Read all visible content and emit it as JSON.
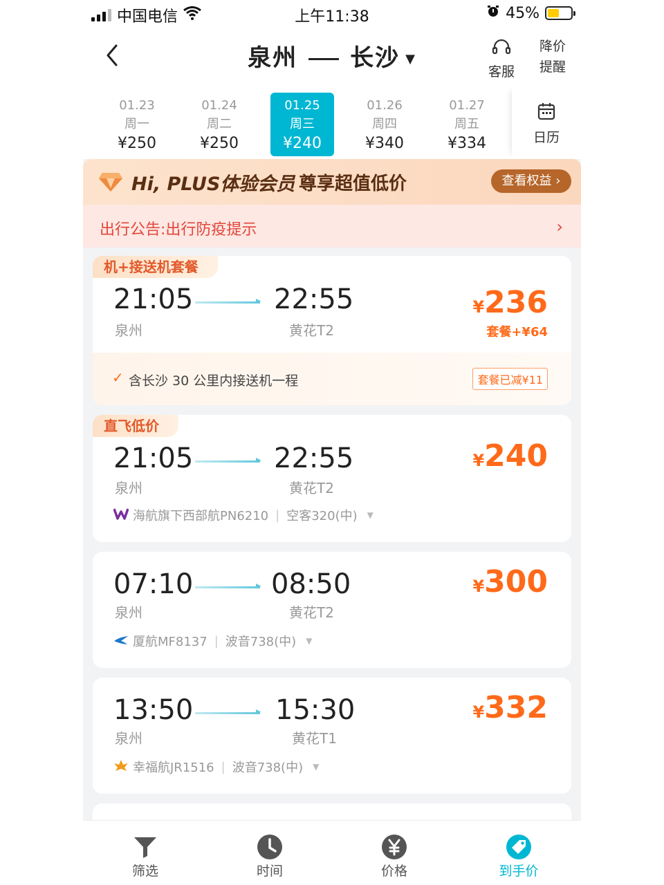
{
  "status_bar": {
    "carrier": "中国电信",
    "time": "上午11:38",
    "battery": "45%"
  },
  "header": {
    "from": "泉州",
    "to": "长沙",
    "service_label": "客服",
    "alert_label_1": "降价",
    "alert_label_2": "提醒"
  },
  "dates": [
    {
      "date": "01.23",
      "weekday": "周一",
      "price": "¥250"
    },
    {
      "date": "01.24",
      "weekday": "周二",
      "price": "¥250"
    },
    {
      "date": "01.25",
      "weekday": "周三",
      "price": "¥240"
    },
    {
      "date": "01.26",
      "weekday": "周四",
      "price": "¥340"
    },
    {
      "date": "01.27",
      "weekday": "周五",
      "price": "¥334"
    }
  ],
  "calendar_label": "日历",
  "plus_banner": {
    "text": "Hi, PLUS体验会员",
    "subtext": "尊享超值低价",
    "cta": "查看权益 ›"
  },
  "notice": {
    "text": "出行公告:出行防疫提示",
    "chevron": "›"
  },
  "flights": [
    {
      "tag": "机+接送机套餐",
      "dep_time": "21:05",
      "dep_city": "泉州",
      "arr_time": "22:55",
      "arr_city": "黄花T2",
      "currency": "¥",
      "price": "236",
      "extra": "套餐+¥64",
      "include_check": "✓",
      "include_text": "含长沙 30 公里内接送机一程",
      "discount_badge": "套餐已减¥11"
    },
    {
      "tag": "直飞低价",
      "dep_time": "21:05",
      "dep_city": "泉州",
      "arr_time": "22:55",
      "arr_city": "黄花T2",
      "currency": "¥",
      "price": "240",
      "airline": "海航旗下西部航PN6210",
      "aircraft": "空客320(中)"
    },
    {
      "dep_time": "07:10",
      "dep_city": "泉州",
      "arr_time": "08:50",
      "arr_city": "黄花T2",
      "currency": "¥",
      "price": "300",
      "airline": "厦航MF8137",
      "aircraft": "波音738(中)"
    },
    {
      "dep_time": "13:50",
      "dep_city": "泉州",
      "arr_time": "15:30",
      "arr_city": "黄花T1",
      "currency": "¥",
      "price": "332",
      "airline": "幸福航JR1516",
      "aircraft": "波音738(中)"
    }
  ],
  "tabs": [
    {
      "label": "筛选",
      "icon": "filter-icon"
    },
    {
      "label": "时间",
      "icon": "clock-icon"
    },
    {
      "label": "价格",
      "icon": "yuan-icon"
    },
    {
      "label": "到手价",
      "icon": "tag-icon"
    }
  ],
  "colors": {
    "accent": "#00b7d3",
    "price": "#ff6a1a",
    "notice": "#e2453a"
  }
}
